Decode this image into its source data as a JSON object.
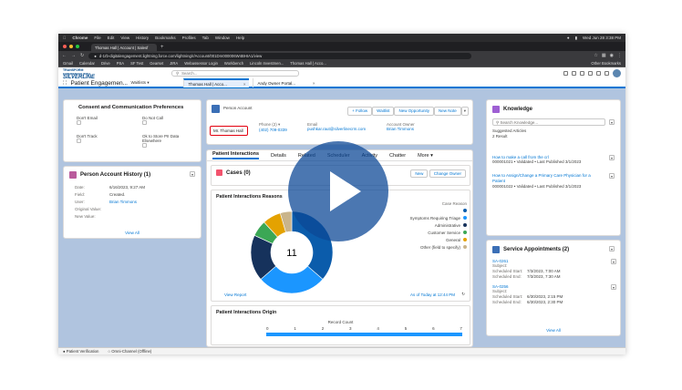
{
  "mac_menu": {
    "chrome": "Chrome",
    "file": "File",
    "edit": "Edit",
    "view": "View",
    "history": "History",
    "bookmarks": "Bookmarks",
    "profiles": "Profiles",
    "tab": "Tab",
    "window": "Window",
    "help": "Help",
    "clock": "Wed Jun 28 3:38 PM"
  },
  "browser": {
    "tab_title": "Thomas Hall | Account | Salesf",
    "url": "d-1rb-digitalengagement.lightning.force.com/lightning/r/Account/001Dm000006W4BHIA1/view",
    "bookmarks": [
      "Gmail",
      "Calendar",
      "Drive",
      "PSA",
      "SF Test",
      "Gearset",
      "JIRA",
      "Webassessor Login",
      "Workbench",
      "Lincoln Investmen...",
      "Thomas Hall | Acco..."
    ],
    "other_bookmarks": "Other Bookmarks"
  },
  "sf_header": {
    "logo_l1": "TRANSFORM",
    "logo_l2": "EXPERIENCES WITH",
    "logo_l3": "SILVERLINE",
    "search_placeholder": "Search..."
  },
  "nav": {
    "app_name": "Patient Engagemen...",
    "waitlists": "Waitlists",
    "tab1": "Thomas Hall | Acco...",
    "tab2": "Andy Owner Portal..."
  },
  "consent": {
    "title": "Consent and Communication Preferences",
    "items": [
      "Don't Email",
      "Do Not Call",
      "Don't Track",
      "Ok to Store PII Data Elsewhere"
    ]
  },
  "history": {
    "title": "Person Account History (1)",
    "rows": [
      {
        "k": "Date:",
        "v": "6/16/2023, 9:27 AM"
      },
      {
        "k": "Field:",
        "v": "Created."
      },
      {
        "k": "User:",
        "v": "Brian Timmons"
      },
      {
        "k": "Original Value:",
        "v": ""
      },
      {
        "k": "New Value:",
        "v": ""
      }
    ],
    "view_all": "View All"
  },
  "account": {
    "type": "Person Account",
    "name": "Mr. Thomas Hall",
    "buttons": {
      "follow": "+ Follow",
      "waitlist": "Waitlist",
      "new_opp": "New Opportunity",
      "new_note": "New Note"
    },
    "phone_label": "Phone (2) ▾",
    "phone": "(402) 709-0339",
    "email_label": "Email",
    "email": "pushkar.raut@silverlinecrm.com",
    "owner_label": "Account Owner",
    "owner": "Brian Timmons"
  },
  "tabs": [
    "Patient Interactions",
    "Details",
    "Related",
    "Scheduler",
    "Activity",
    "Chatter",
    "More"
  ],
  "cases": {
    "title": "Cases (0)",
    "new": "New",
    "change_owner": "Change Owner"
  },
  "chart_data": {
    "type": "pie",
    "title": "Patient Interactions Reasons",
    "center_label": "11",
    "legend_title": "Case Reason",
    "legend": [
      {
        "name": "",
        "color": "#0b5cab"
      },
      {
        "name": "Symptoms Requiring Triage",
        "color": "#1b96ff"
      },
      {
        "name": "Administrative",
        "color": "#16325c"
      },
      {
        "name": "Customer Service",
        "color": "#3ba755"
      },
      {
        "name": "General",
        "color": "#e4a201"
      },
      {
        "name": "Other (field to specify)",
        "color": "#c9b48b"
      }
    ],
    "values": [
      4,
      3,
      2,
      0.7,
      0.8,
      0.5
    ],
    "view_report": "View Report",
    "as_of": "As of Today at 12:44 PM"
  },
  "origin": {
    "title": "Patient Interactions Origin",
    "record_count": "Record Count",
    "ticks": [
      "0",
      "1",
      "2",
      "3",
      "4",
      "5",
      "6",
      "7"
    ]
  },
  "knowledge": {
    "title": "Knowledge",
    "search_placeholder": "Search Knowledge...",
    "suggested": "Suggested Articles",
    "results": "2 Result",
    "articles": [
      {
        "title": "How to make a call from the crl",
        "meta": "000001021 • Validated • Last Published 3/1/2023"
      },
      {
        "title": "How to Assign/Change a Primary Care Physician for a Patient",
        "meta": "000001022 • Validated • Last Published 3/1/2023"
      }
    ]
  },
  "appointments": {
    "title": "Service Appointments (2)",
    "items": [
      {
        "id": "SA-0261",
        "subject": "Subject:",
        "start_label": "Scheduled Start:",
        "start": "7/3/2023, 7:00 AM",
        "end_label": "Scheduled End:",
        "end": "7/3/2023, 7:30 AM"
      },
      {
        "id": "SA-0256",
        "subject": "Subject:",
        "start_label": "Scheduled Start:",
        "start": "6/30/2023, 2:15 PM",
        "end_label": "Scheduled End:",
        "end": "6/30/2023, 2:30 PM"
      }
    ],
    "view_all": "View All"
  },
  "footer": {
    "patient_verification": "Patient Verification",
    "omni": "Omni-Channel (Offline)"
  },
  "colors": {
    "brand": "#0176d3",
    "play_overlay": "#0c4896",
    "highlight": "#e3000f"
  }
}
